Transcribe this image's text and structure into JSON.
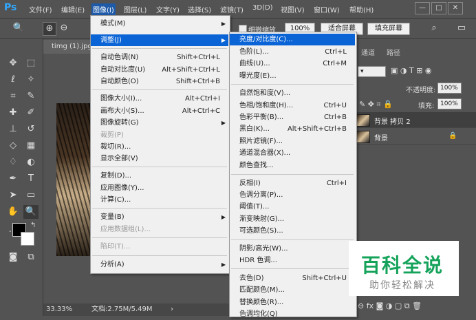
{
  "menubar": {
    "logo": "Ps",
    "items": [
      "文件(F)",
      "编辑(E)",
      "图像(I)",
      "图层(L)",
      "文字(Y)",
      "选择(S)",
      "滤镜(T)",
      "3D(D)",
      "视图(V)",
      "窗口(W)",
      "帮助(H)"
    ],
    "active_index": 2,
    "window_buttons": [
      "—",
      "□",
      "✕"
    ]
  },
  "options": {
    "fine_zoom_label": "细微缩放",
    "zoom_value": "100%",
    "fit_screen": "适合屏幕",
    "fill_screen": "填充屏幕"
  },
  "document": {
    "tab_name": "timg (1).jpg"
  },
  "status": {
    "zoom": "33.33%",
    "doc_info": "文档:2.75M/5.49M",
    "arrow": "›"
  },
  "right_panel": {
    "tabs": [
      "通道",
      "路径"
    ],
    "opacity_label": "不透明度:",
    "opacity_value": "100%",
    "fill_label": "填充:",
    "fill_value": "100%",
    "layers": [
      {
        "name": "背景 拷贝 2",
        "selected": true
      },
      {
        "name": "背景",
        "selected": false
      }
    ]
  },
  "image_menu": {
    "items": [
      {
        "label": "模式(M)",
        "shortcut": "",
        "submenu": true,
        "disabled": false
      },
      {
        "label": "调整(J)",
        "shortcut": "",
        "submenu": true,
        "disabled": false,
        "highlight": true
      },
      {
        "label": "自动色调(N)",
        "shortcut": "Shift+Ctrl+L",
        "submenu": false,
        "disabled": false
      },
      {
        "label": "自动对比度(U)",
        "shortcut": "Alt+Shift+Ctrl+L",
        "submenu": false,
        "disabled": false
      },
      {
        "label": "自动颜色(O)",
        "shortcut": "Shift+Ctrl+B",
        "submenu": false,
        "disabled": false
      },
      {
        "label": "图像大小(I)...",
        "shortcut": "Alt+Ctrl+I",
        "submenu": false,
        "disabled": false
      },
      {
        "label": "画布大小(S)...",
        "shortcut": "Alt+Ctrl+C",
        "submenu": false,
        "disabled": false
      },
      {
        "label": "图像旋转(G)",
        "shortcut": "",
        "submenu": true,
        "disabled": false
      },
      {
        "label": "裁剪(P)",
        "shortcut": "",
        "submenu": false,
        "disabled": true
      },
      {
        "label": "裁切(R)...",
        "shortcut": "",
        "submenu": false,
        "disabled": false
      },
      {
        "label": "显示全部(V)",
        "shortcut": "",
        "submenu": false,
        "disabled": false
      },
      {
        "label": "复制(D)...",
        "shortcut": "",
        "submenu": false,
        "disabled": false
      },
      {
        "label": "应用图像(Y)...",
        "shortcut": "",
        "submenu": false,
        "disabled": false
      },
      {
        "label": "计算(C)...",
        "shortcut": "",
        "submenu": false,
        "disabled": false
      },
      {
        "label": "变量(B)",
        "shortcut": "",
        "submenu": true,
        "disabled": false
      },
      {
        "label": "应用数据组(L)...",
        "shortcut": "",
        "submenu": false,
        "disabled": true
      },
      {
        "label": "陷印(T)...",
        "shortcut": "",
        "submenu": false,
        "disabled": true
      },
      {
        "label": "分析(A)",
        "shortcut": "",
        "submenu": true,
        "disabled": false
      }
    ]
  },
  "adjust_menu": {
    "items": [
      {
        "label": "亮度/对比度(C)...",
        "shortcut": "",
        "highlight": true
      },
      {
        "label": "色阶(L)...",
        "shortcut": "Ctrl+L"
      },
      {
        "label": "曲线(U)...",
        "shortcut": "Ctrl+M"
      },
      {
        "label": "曝光度(E)...",
        "shortcut": ""
      },
      {
        "label": "自然饱和度(V)...",
        "shortcut": ""
      },
      {
        "label": "色相/饱和度(H)...",
        "shortcut": "Ctrl+U"
      },
      {
        "label": "色彩平衡(B)...",
        "shortcut": "Ctrl+B"
      },
      {
        "label": "黑白(K)...",
        "shortcut": "Alt+Shift+Ctrl+B"
      },
      {
        "label": "照片滤镜(F)...",
        "shortcut": ""
      },
      {
        "label": "通道混合器(X)...",
        "shortcut": ""
      },
      {
        "label": "颜色查找...",
        "shortcut": ""
      },
      {
        "label": "反相(I)",
        "shortcut": "Ctrl+I"
      },
      {
        "label": "色调分离(P)...",
        "shortcut": ""
      },
      {
        "label": "阈值(T)...",
        "shortcut": ""
      },
      {
        "label": "渐变映射(G)...",
        "shortcut": ""
      },
      {
        "label": "可选颜色(S)...",
        "shortcut": ""
      },
      {
        "label": "阴影/高光(W)...",
        "shortcut": ""
      },
      {
        "label": "HDR 色调...",
        "shortcut": ""
      },
      {
        "label": "去色(D)",
        "shortcut": "Shift+Ctrl+U"
      },
      {
        "label": "匹配颜色(M)...",
        "shortcut": ""
      },
      {
        "label": "替换颜色(R)...",
        "shortcut": ""
      },
      {
        "label": "色调均化(Q)",
        "shortcut": ""
      }
    ]
  },
  "watermark": {
    "big": "百科全说",
    "small": "助你轻松解决"
  },
  "colors": {
    "ui_dark": "#535353",
    "menu_bg": "#f0f0f0",
    "highlight": "#0a64d6",
    "watermark_green": "#15a35b"
  }
}
